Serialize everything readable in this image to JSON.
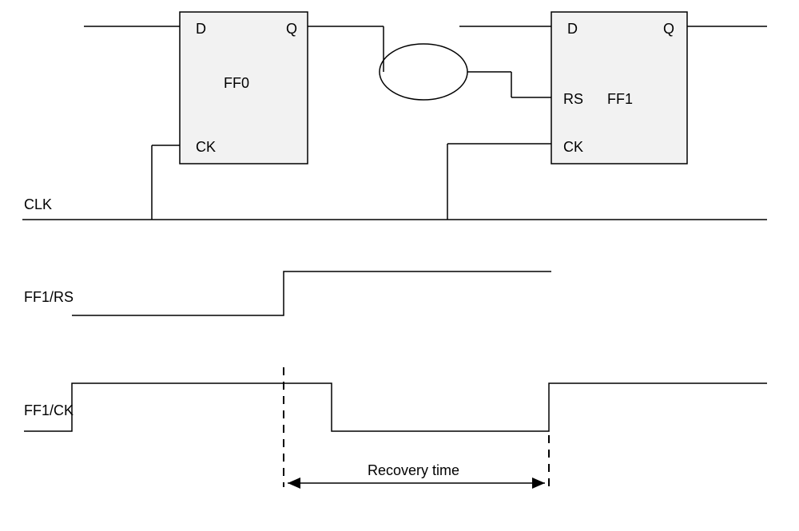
{
  "ff0": {
    "name": "FF0",
    "d": "D",
    "q": "Q",
    "ck": "CK"
  },
  "ff1": {
    "name": "FF1",
    "d": "D",
    "q": "Q",
    "rs": "RS",
    "ck": "CK"
  },
  "signals": {
    "clk": "CLK",
    "ff1_rs": "FF1/RS",
    "ff1_ck": "FF1/CK"
  },
  "annotation": {
    "recovery_time": "Recovery time"
  }
}
